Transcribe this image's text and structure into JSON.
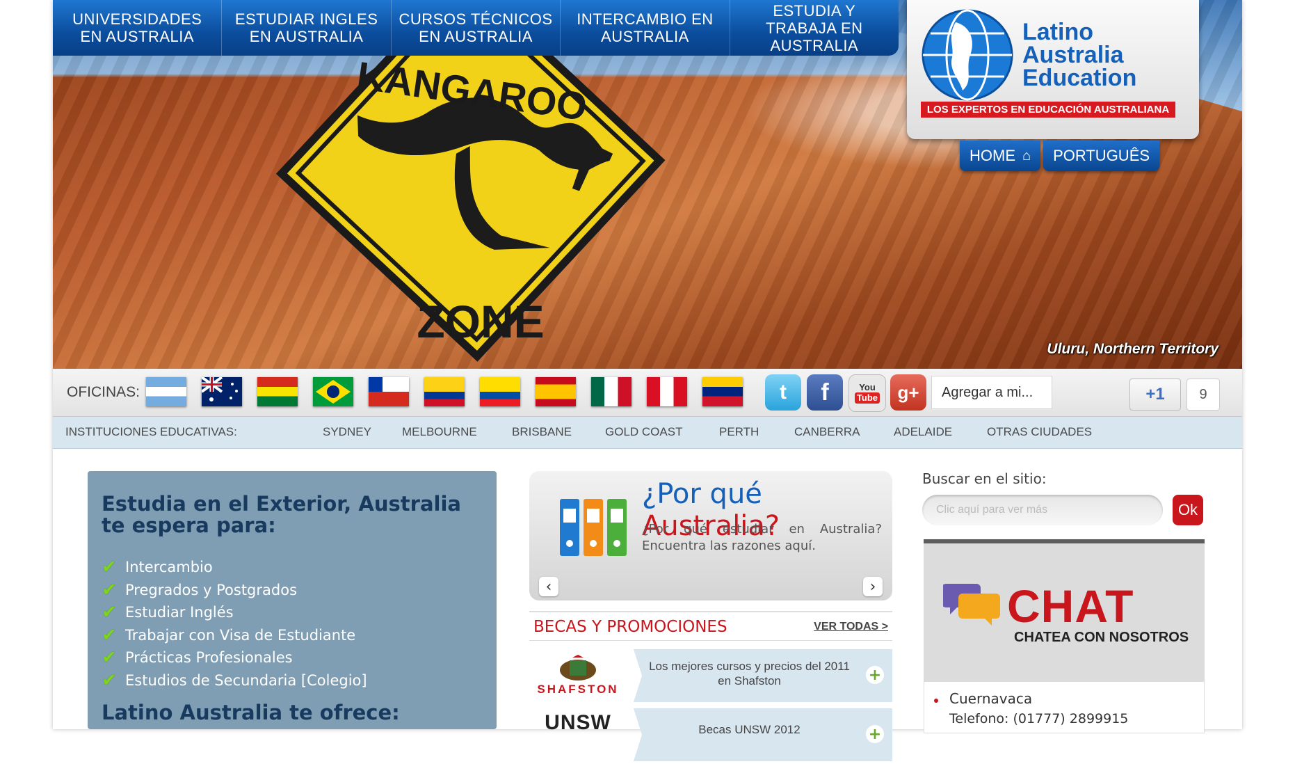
{
  "nav": {
    "items": [
      {
        "label": "UNIVERSIDADES EN AUSTRALIA"
      },
      {
        "label": "ESTUDIAR INGLES EN AUSTRALIA"
      },
      {
        "label": "CURSOS TÉCNICOS EN AUSTRALIA"
      },
      {
        "label": "INTERCAMBIO EN AUSTRALIA"
      },
      {
        "label": "ESTUDIA Y TRABAJA EN AUSTRALIA"
      }
    ]
  },
  "hero": {
    "sign_top": "KANGAROO",
    "sign_bottom": "ZONE",
    "caption": "Uluru, Northern Territory"
  },
  "logo": {
    "line1": "Latino",
    "line2": "Australia",
    "line3": "Education",
    "tagline": "LOS EXPERTOS EN EDUCACIÓN AUSTRALIANA"
  },
  "top_links": {
    "home": "HOME",
    "portugues": "PORTUGUÊS"
  },
  "offices": {
    "label": "OFICINAS:",
    "flags": [
      "argentina-flag",
      "australia-flag",
      "bolivia-flag",
      "brazil-flag",
      "chile-flag",
      "colombia-flag",
      "ecuador-flag",
      "spain-flag",
      "mexico-flag",
      "peru-flag",
      "venezuela-flag"
    ],
    "social": [
      "twitter-icon",
      "facebook-icon",
      "youtube-icon",
      "google-plus-icon"
    ],
    "youtube_you": "You",
    "youtube_tube": "Tube",
    "agregar": "Agregar a mi...",
    "plusone": "+1",
    "plusone_count": "9"
  },
  "institutions": {
    "label": "INSTITUCIONES EDUCATIVAS:",
    "cities": [
      "SYDNEY",
      "MELBOURNE",
      "BRISBANE",
      "GOLD COAST",
      "PERTH",
      "CANBERRA",
      "ADELAIDE",
      "OTRAS CIUDADES"
    ]
  },
  "left_panel": {
    "title": "Estudia en el Exterior, Australia te espera para:",
    "items": [
      "Intercambio",
      "Pregrados y Postgrados",
      "Estudiar Inglés",
      "Trabajar con Visa de Estudiante",
      "Prácticas Profesionales",
      "Estudios de Secundaria [Colegio]"
    ],
    "subtitle": "Latino Australia te ofrece:"
  },
  "why": {
    "title_a": "¿Por qué ",
    "title_b": "Australia?",
    "description": "¿Por qué estudiar en Australia? Encuentra las razones aquí."
  },
  "becas": {
    "title": "BECAS Y PROMOCIONES",
    "ver_todas": "VER TODAS >",
    "promos": [
      {
        "logo": "SHAFSTON",
        "text": "Los mejores cursos y precios del 2011 en Shafston"
      },
      {
        "logo": "UNSW",
        "text": "Becas UNSW 2012"
      }
    ]
  },
  "search": {
    "label": "Buscar en el sitio:",
    "placeholder": "Clic aquí para ver más",
    "button": "Ok"
  },
  "chat": {
    "big": "CHAT",
    "small": "CHATEA CON NOSOTROS",
    "office_city": "Cuernavaca",
    "office_phone": "Telefono: (01777) 2899915"
  }
}
